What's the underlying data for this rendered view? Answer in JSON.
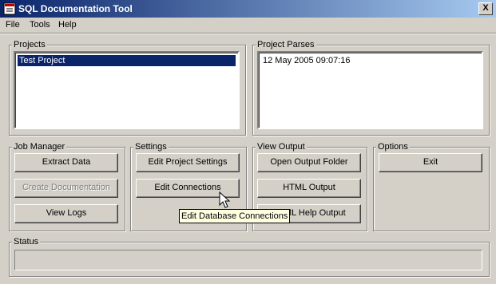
{
  "window": {
    "title": "SQL Documentation Tool",
    "close_label": "X"
  },
  "menu": {
    "file": "File",
    "tools": "Tools",
    "help": "Help"
  },
  "projects": {
    "label": "Projects",
    "items": [
      "Test Project"
    ],
    "selected": "Test Project"
  },
  "project_parses": {
    "label": "Project Parses",
    "items": [
      "12 May 2005 09:07:16"
    ]
  },
  "job_manager": {
    "label": "Job Manager",
    "extract": "Extract Data",
    "create_doc": "Create Documentation",
    "view_logs": "View Logs"
  },
  "settings": {
    "label": "Settings",
    "edit_project": "Edit Project Settings",
    "edit_connections": "Edit Connections"
  },
  "view_output": {
    "label": "View Output",
    "open_folder": "Open Output Folder",
    "html_output": "HTML Output",
    "html_help_output": "HTML Help Output"
  },
  "options": {
    "label": "Options",
    "exit": "Exit"
  },
  "status": {
    "label": "Status",
    "text": ""
  },
  "tooltip": {
    "text": "Edit Database Connections"
  },
  "colors": {
    "title_bar_start": "#0a246a",
    "title_bar_end": "#a6caf0",
    "face": "#d4d0c8",
    "tooltip_bg": "#ffffe1"
  }
}
